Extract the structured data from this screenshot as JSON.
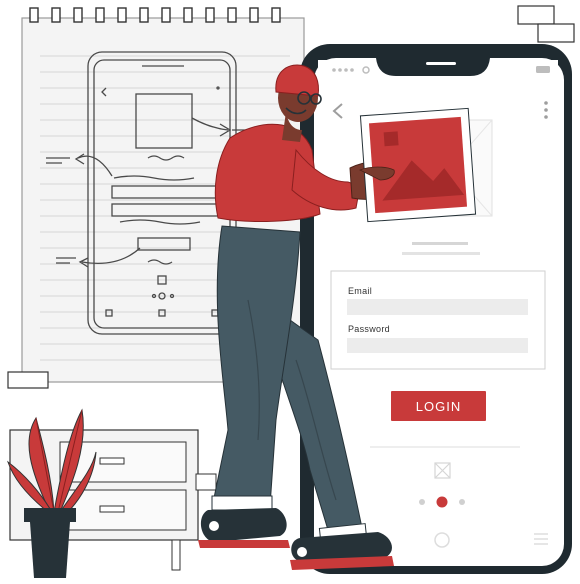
{
  "login_form": {
    "email_label": "Email",
    "password_label": "Password",
    "login_button": "LOGIN"
  },
  "colors": {
    "accent_red": "#c83a3a",
    "dark_navy": "#263238",
    "phone_frame": "#1f2a30",
    "pants_gray": "#455a64",
    "paper": "#f3f3f3",
    "line_gray": "#d9d9d9"
  },
  "icons": [
    "back-arrow-icon",
    "kebab-menu-icon",
    "image-placeholder-icon",
    "pagination-dots-icon",
    "home-button-icon",
    "menu-lines-icon"
  ]
}
